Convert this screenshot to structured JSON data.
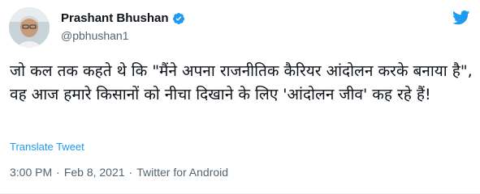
{
  "author": {
    "name": "Prashant Bhushan",
    "handle": "@pbhushan1",
    "verified": true,
    "avatar_icon": "avatar-photo"
  },
  "brand": {
    "icon": "twitter-bird-icon",
    "color": "#1d9bf0"
  },
  "tweet": {
    "text": "जो कल तक कहते थे कि \"मैंने अपना राजनीतिक कैरियर आंदोलन करके बनाया है\", वह आज हमारे किसानों को नीचा दिखाने के लिए 'आंदोलन जीव' कह रहे हैं!",
    "translate_label": "Translate Tweet"
  },
  "meta": {
    "time": "3:00 PM",
    "separator": "·",
    "date": "Feb 8, 2021",
    "source": "Twitter for Android"
  },
  "colors": {
    "text": "#0f1419",
    "secondary": "#536471",
    "link": "#1d9bf0"
  }
}
